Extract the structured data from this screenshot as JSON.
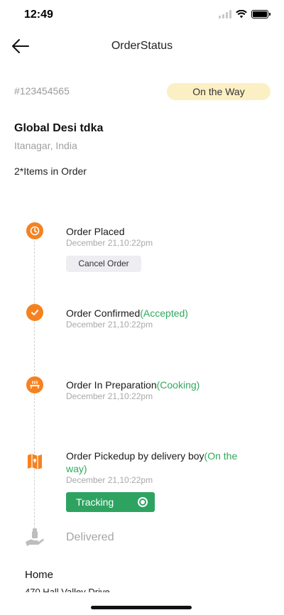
{
  "status_bar": {
    "time": "12:49"
  },
  "header": {
    "title": "OrderStatus",
    "back_icon": "arrow-left-icon"
  },
  "order": {
    "id": "#123454565",
    "status_badge": "On the Way",
    "restaurant_name": "Global Desi tdka",
    "restaurant_location": "Itanagar, India",
    "items_count": "2*Items in Order"
  },
  "timeline": {
    "steps": [
      {
        "title": "Order Placed",
        "highlight": "",
        "date": "December 21,10:22pm",
        "icon": "clock-icon"
      },
      {
        "title": "Order Confirmed",
        "highlight": "(Accepted)",
        "date": "December 21,10:22pm",
        "icon": "check-icon"
      },
      {
        "title": "Order In Preparation",
        "highlight": "(Cooking)",
        "date": "December 21,10:22pm",
        "icon": "food-tray-icon"
      },
      {
        "title": "Order Pickedup by delivery boy",
        "highlight": "(On the way)",
        "date": "December 21,10:22pm",
        "icon": "map-icon"
      }
    ],
    "cancel_label": "Cancel Order",
    "tracking_label": "Tracking",
    "delivered_label": "Delivered"
  },
  "address": {
    "title": "Home",
    "line": "470 Hall Valley Drive"
  },
  "colors": {
    "accent_orange": "#f58220",
    "accent_green": "#2eaa5c",
    "pill_bg": "#fbefc4"
  }
}
